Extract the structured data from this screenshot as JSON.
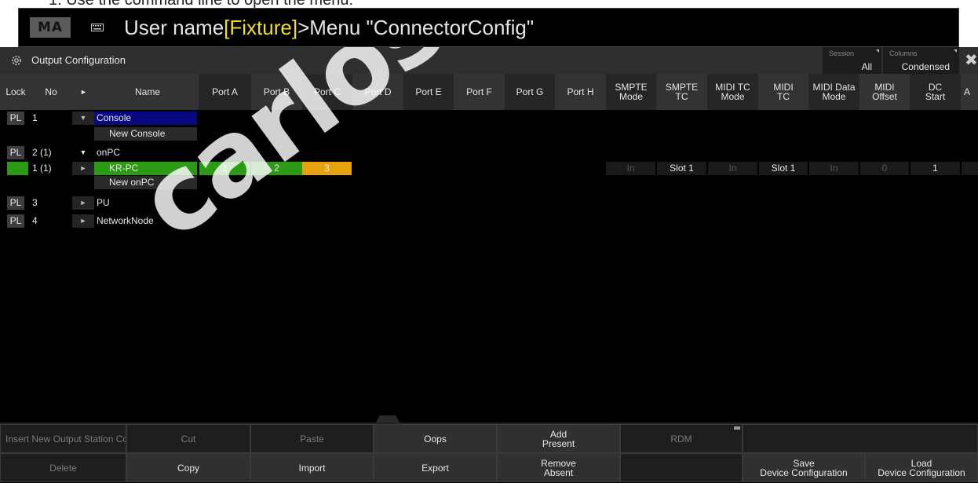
{
  "instruction": "1.   Use the command line to open the menu:",
  "command_line": {
    "logo": "MA",
    "prefix": "User name",
    "highlight": "[Fixture]",
    "suffix": ">Menu \"ConnectorConfig\""
  },
  "window": {
    "title": "Output Configuration",
    "session_label": "Session",
    "session_value": "All",
    "columns_label": "Columns",
    "columns_value": "Condensed",
    "close": "✖"
  },
  "headers": {
    "lock": "Lock",
    "no": "No",
    "arrow": "►",
    "name": "Name",
    "ports": [
      "Port A",
      "Port B",
      "Port C",
      "Port D",
      "Port E",
      "Port F",
      "Port G",
      "Port H"
    ],
    "smpte_mode": [
      "SMPTE",
      "Mode"
    ],
    "smpte_tc": [
      "SMPTE",
      "TC"
    ],
    "midi_tc_mode": [
      "MIDI TC",
      "Mode"
    ],
    "midi_tc": [
      "MIDI",
      "TC"
    ],
    "midi_data_mode": [
      "MIDI Data",
      "Mode"
    ],
    "midi_offset": [
      "MIDI",
      "Offset"
    ],
    "dc_start": [
      "DC",
      "Start"
    ],
    "last": "A"
  },
  "rows": {
    "console": {
      "lock": "PL",
      "no": "1",
      "arrow": "▼",
      "name": "Console"
    },
    "new_console": {
      "name": "New Console"
    },
    "onpc": {
      "lock": "PL",
      "no": "2 (1)",
      "arrow": "▼",
      "name": "onPC"
    },
    "krpc": {
      "no": "1 (1)",
      "arrow": "►",
      "name": "KR-PC",
      "ports": [
        "1",
        "2",
        "3"
      ],
      "smpte_mode": "In",
      "smpte_tc": "Slot 1",
      "midi_tc_mode": "In",
      "midi_tc": "Slot 1",
      "midi_data_mode": "In",
      "midi_offset": "0",
      "dc_start": "1"
    },
    "new_onpc": {
      "name": "New onPC"
    },
    "pu": {
      "lock": "PL",
      "no": "3",
      "arrow": "►",
      "name": "PU"
    },
    "networknode": {
      "lock": "PL",
      "no": "4",
      "arrow": "►",
      "name": "NetworkNode"
    }
  },
  "buttons": {
    "insert": "Insert New Output Station Cc",
    "cut": "Cut",
    "paste": "Paste",
    "oops": "Oops",
    "add_present": [
      "Add",
      "Present"
    ],
    "rdm": "RDM",
    "delete": "Delete",
    "copy": "Copy",
    "import": "Import",
    "export": "Export",
    "remove_absent": [
      "Remove",
      "Absent"
    ],
    "save_config": [
      "Save",
      "Device Configuration"
    ],
    "load_config": [
      "Load",
      "Device Configuration"
    ]
  },
  "watermark": "carlosmendo",
  "colors": {
    "highlight_yellow": "#f3df24",
    "console_blue": "#080880",
    "active_green": "#2b9a14",
    "port_orange": "#e5a20c"
  }
}
